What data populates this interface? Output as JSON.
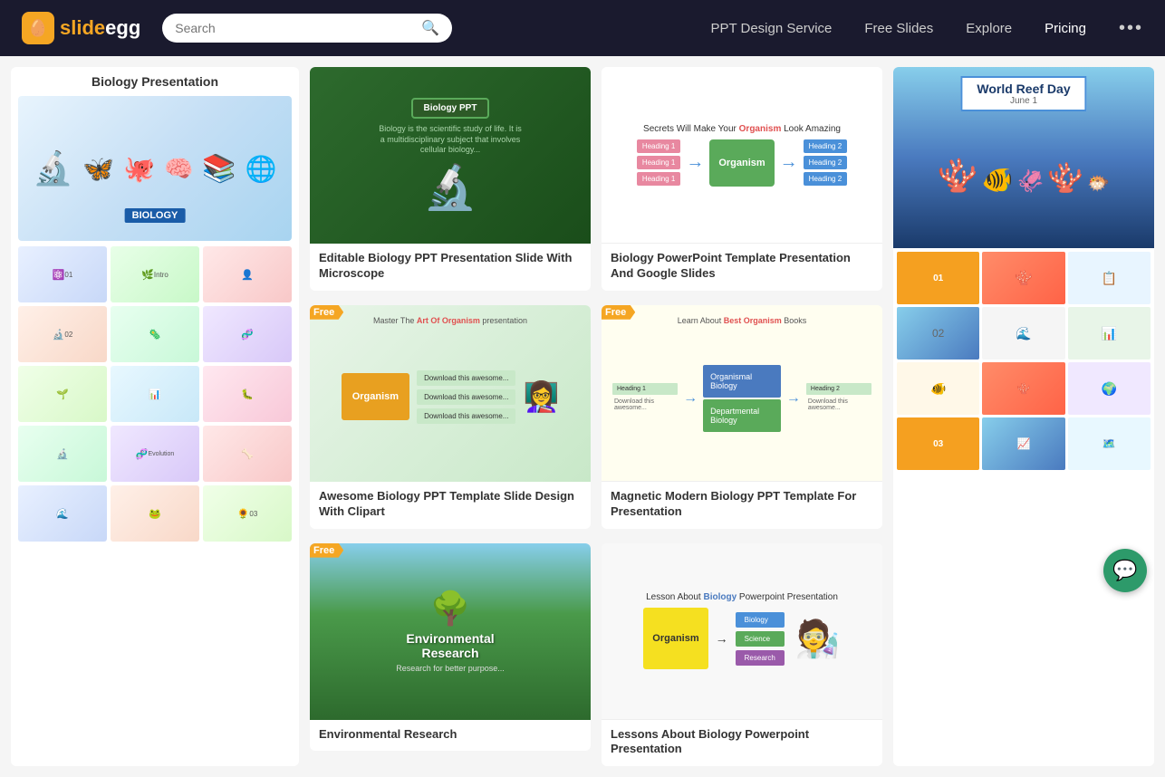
{
  "header": {
    "logo_text": "slideegg",
    "logo_icon": "🥚",
    "search_placeholder": "Search",
    "nav": {
      "ppt_design": "PPT Design Service",
      "free_slides": "Free Slides",
      "explore": "Explore",
      "pricing": "Pricing"
    }
  },
  "left_deck": {
    "title": "Biology Presentation",
    "slide_count": "Slide deck preview"
  },
  "templates": {
    "col1": [
      {
        "id": "bio-microscope",
        "free": false,
        "title": "Editable Biology PPT Presentation Slide With Microscope",
        "type": "microscope"
      },
      {
        "id": "bio-awesome",
        "free": true,
        "title": "Awesome Biology PPT Template Slide Design With Clipart",
        "type": "organism-diagram"
      },
      {
        "id": "env-research",
        "free": true,
        "title": "Environmental Research",
        "type": "environment"
      }
    ],
    "col2": [
      {
        "id": "bio-powerpoint",
        "free": false,
        "title": "Biology PowerPoint Template Presentation And Google Slides",
        "type": "secrets"
      },
      {
        "id": "bio-magnetic",
        "free": true,
        "title": "Magnetic Modern Biology PPT Template For Presentation",
        "type": "organism-arrows"
      },
      {
        "id": "bio-lesson",
        "free": false,
        "title": "Lessons About Biology Powerpoint Presentation",
        "type": "lesson"
      }
    ]
  },
  "right_deck": {
    "title": "World Reef Day",
    "subtitle": "June 1"
  },
  "badges": {
    "free": "Free"
  },
  "labels": {
    "biology": "BIOLOGY",
    "organism": "Organism",
    "bio_ppt": "Biology PPT",
    "heading1": "Heading 1",
    "heading2": "Heading 2",
    "org_bio": "Organismal Biology",
    "dep_bio": "Departmental Biology"
  }
}
